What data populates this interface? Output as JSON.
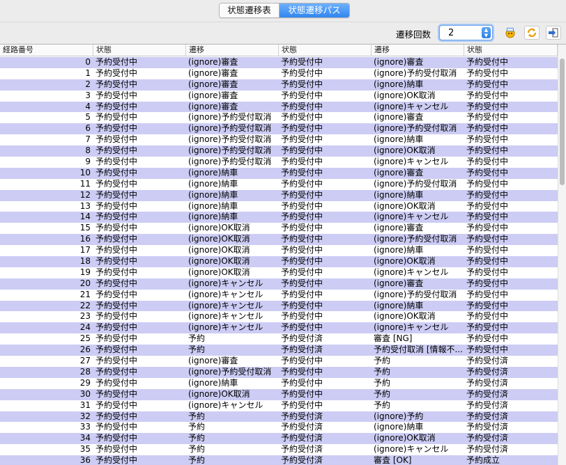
{
  "tabs": {
    "table_label": "状態遷移表",
    "path_label": "状態遷移パス"
  },
  "toolbar": {
    "count_label": "遷移回数",
    "count_value": "2",
    "icons": [
      "debug-icon",
      "refresh-icon",
      "export-icon"
    ]
  },
  "colors": {
    "alt_row": "#ccccf5",
    "accent": "#2f86f0"
  },
  "columns": [
    "経路番号",
    "状態",
    "遷移",
    "状態",
    "遷移",
    "状態"
  ],
  "rows": [
    [
      "0",
      "予約受付中",
      "(ignore)審査",
      "予約受付中",
      "(ignore)審査",
      "予約受付中"
    ],
    [
      "1",
      "予約受付中",
      "(ignore)審査",
      "予約受付中",
      "(ignore)予約受付取消",
      "予約受付中"
    ],
    [
      "2",
      "予約受付中",
      "(ignore)審査",
      "予約受付中",
      "(ignore)納車",
      "予約受付中"
    ],
    [
      "3",
      "予約受付中",
      "(ignore)審査",
      "予約受付中",
      "(ignore)OK取消",
      "予約受付中"
    ],
    [
      "4",
      "予約受付中",
      "(ignore)審査",
      "予約受付中",
      "(ignore)キャンセル",
      "予約受付中"
    ],
    [
      "5",
      "予約受付中",
      "(ignore)予約受付取消",
      "予約受付中",
      "(ignore)審査",
      "予約受付中"
    ],
    [
      "6",
      "予約受付中",
      "(ignore)予約受付取消",
      "予約受付中",
      "(ignore)予約受付取消",
      "予約受付中"
    ],
    [
      "7",
      "予約受付中",
      "(ignore)予約受付取消",
      "予約受付中",
      "(ignore)納車",
      "予約受付中"
    ],
    [
      "8",
      "予約受付中",
      "(ignore)予約受付取消",
      "予約受付中",
      "(ignore)OK取消",
      "予約受付中"
    ],
    [
      "9",
      "予約受付中",
      "(ignore)予約受付取消",
      "予約受付中",
      "(ignore)キャンセル",
      "予約受付中"
    ],
    [
      "10",
      "予約受付中",
      "(ignore)納車",
      "予約受付中",
      "(ignore)審査",
      "予約受付中"
    ],
    [
      "11",
      "予約受付中",
      "(ignore)納車",
      "予約受付中",
      "(ignore)予約受付取消",
      "予約受付中"
    ],
    [
      "12",
      "予約受付中",
      "(ignore)納車",
      "予約受付中",
      "(ignore)納車",
      "予約受付中"
    ],
    [
      "13",
      "予約受付中",
      "(ignore)納車",
      "予約受付中",
      "(ignore)OK取消",
      "予約受付中"
    ],
    [
      "14",
      "予約受付中",
      "(ignore)納車",
      "予約受付中",
      "(ignore)キャンセル",
      "予約受付中"
    ],
    [
      "15",
      "予約受付中",
      "(ignore)OK取消",
      "予約受付中",
      "(ignore)審査",
      "予約受付中"
    ],
    [
      "16",
      "予約受付中",
      "(ignore)OK取消",
      "予約受付中",
      "(ignore)予約受付取消",
      "予約受付中"
    ],
    [
      "17",
      "予約受付中",
      "(ignore)OK取消",
      "予約受付中",
      "(ignore)納車",
      "予約受付中"
    ],
    [
      "18",
      "予約受付中",
      "(ignore)OK取消",
      "予約受付中",
      "(ignore)OK取消",
      "予約受付中"
    ],
    [
      "19",
      "予約受付中",
      "(ignore)OK取消",
      "予約受付中",
      "(ignore)キャンセル",
      "予約受付中"
    ],
    [
      "20",
      "予約受付中",
      "(ignore)キャンセル",
      "予約受付中",
      "(ignore)審査",
      "予約受付中"
    ],
    [
      "21",
      "予約受付中",
      "(ignore)キャンセル",
      "予約受付中",
      "(ignore)予約受付取消",
      "予約受付中"
    ],
    [
      "22",
      "予約受付中",
      "(ignore)キャンセル",
      "予約受付中",
      "(ignore)納車",
      "予約受付中"
    ],
    [
      "23",
      "予約受付中",
      "(ignore)キャンセル",
      "予約受付中",
      "(ignore)OK取消",
      "予約受付中"
    ],
    [
      "24",
      "予約受付中",
      "(ignore)キャンセル",
      "予約受付中",
      "(ignore)キャンセル",
      "予約受付中"
    ],
    [
      "25",
      "予約受付中",
      "予約",
      "予約受付済",
      "審査 [NG]",
      "予約受付中"
    ],
    [
      "26",
      "予約受付中",
      "予約",
      "予約受付済",
      "予約受付取消 [情報不...",
      "予約受付中"
    ],
    [
      "27",
      "予約受付中",
      "(ignore)審査",
      "予約受付中",
      "予約",
      "予約受付済"
    ],
    [
      "28",
      "予約受付中",
      "(ignore)予約受付取消",
      "予約受付中",
      "予約",
      "予約受付済"
    ],
    [
      "29",
      "予約受付中",
      "(ignore)納車",
      "予約受付中",
      "予約",
      "予約受付済"
    ],
    [
      "30",
      "予約受付中",
      "(ignore)OK取消",
      "予約受付中",
      "予約",
      "予約受付済"
    ],
    [
      "31",
      "予約受付中",
      "(ignore)キャンセル",
      "予約受付中",
      "予約",
      "予約受付済"
    ],
    [
      "32",
      "予約受付中",
      "予約",
      "予約受付済",
      "(ignore)予約",
      "予約受付済"
    ],
    [
      "33",
      "予約受付中",
      "予約",
      "予約受付済",
      "(ignore)納車",
      "予約受付済"
    ],
    [
      "34",
      "予約受付中",
      "予約",
      "予約受付済",
      "(ignore)OK取消",
      "予約受付済"
    ],
    [
      "35",
      "予約受付中",
      "予約",
      "予約受付済",
      "(ignore)キャンセル",
      "予約受付済"
    ],
    [
      "36",
      "予約受付中",
      "予約",
      "予約受付済",
      "審査 [OK]",
      "予約成立"
    ]
  ]
}
